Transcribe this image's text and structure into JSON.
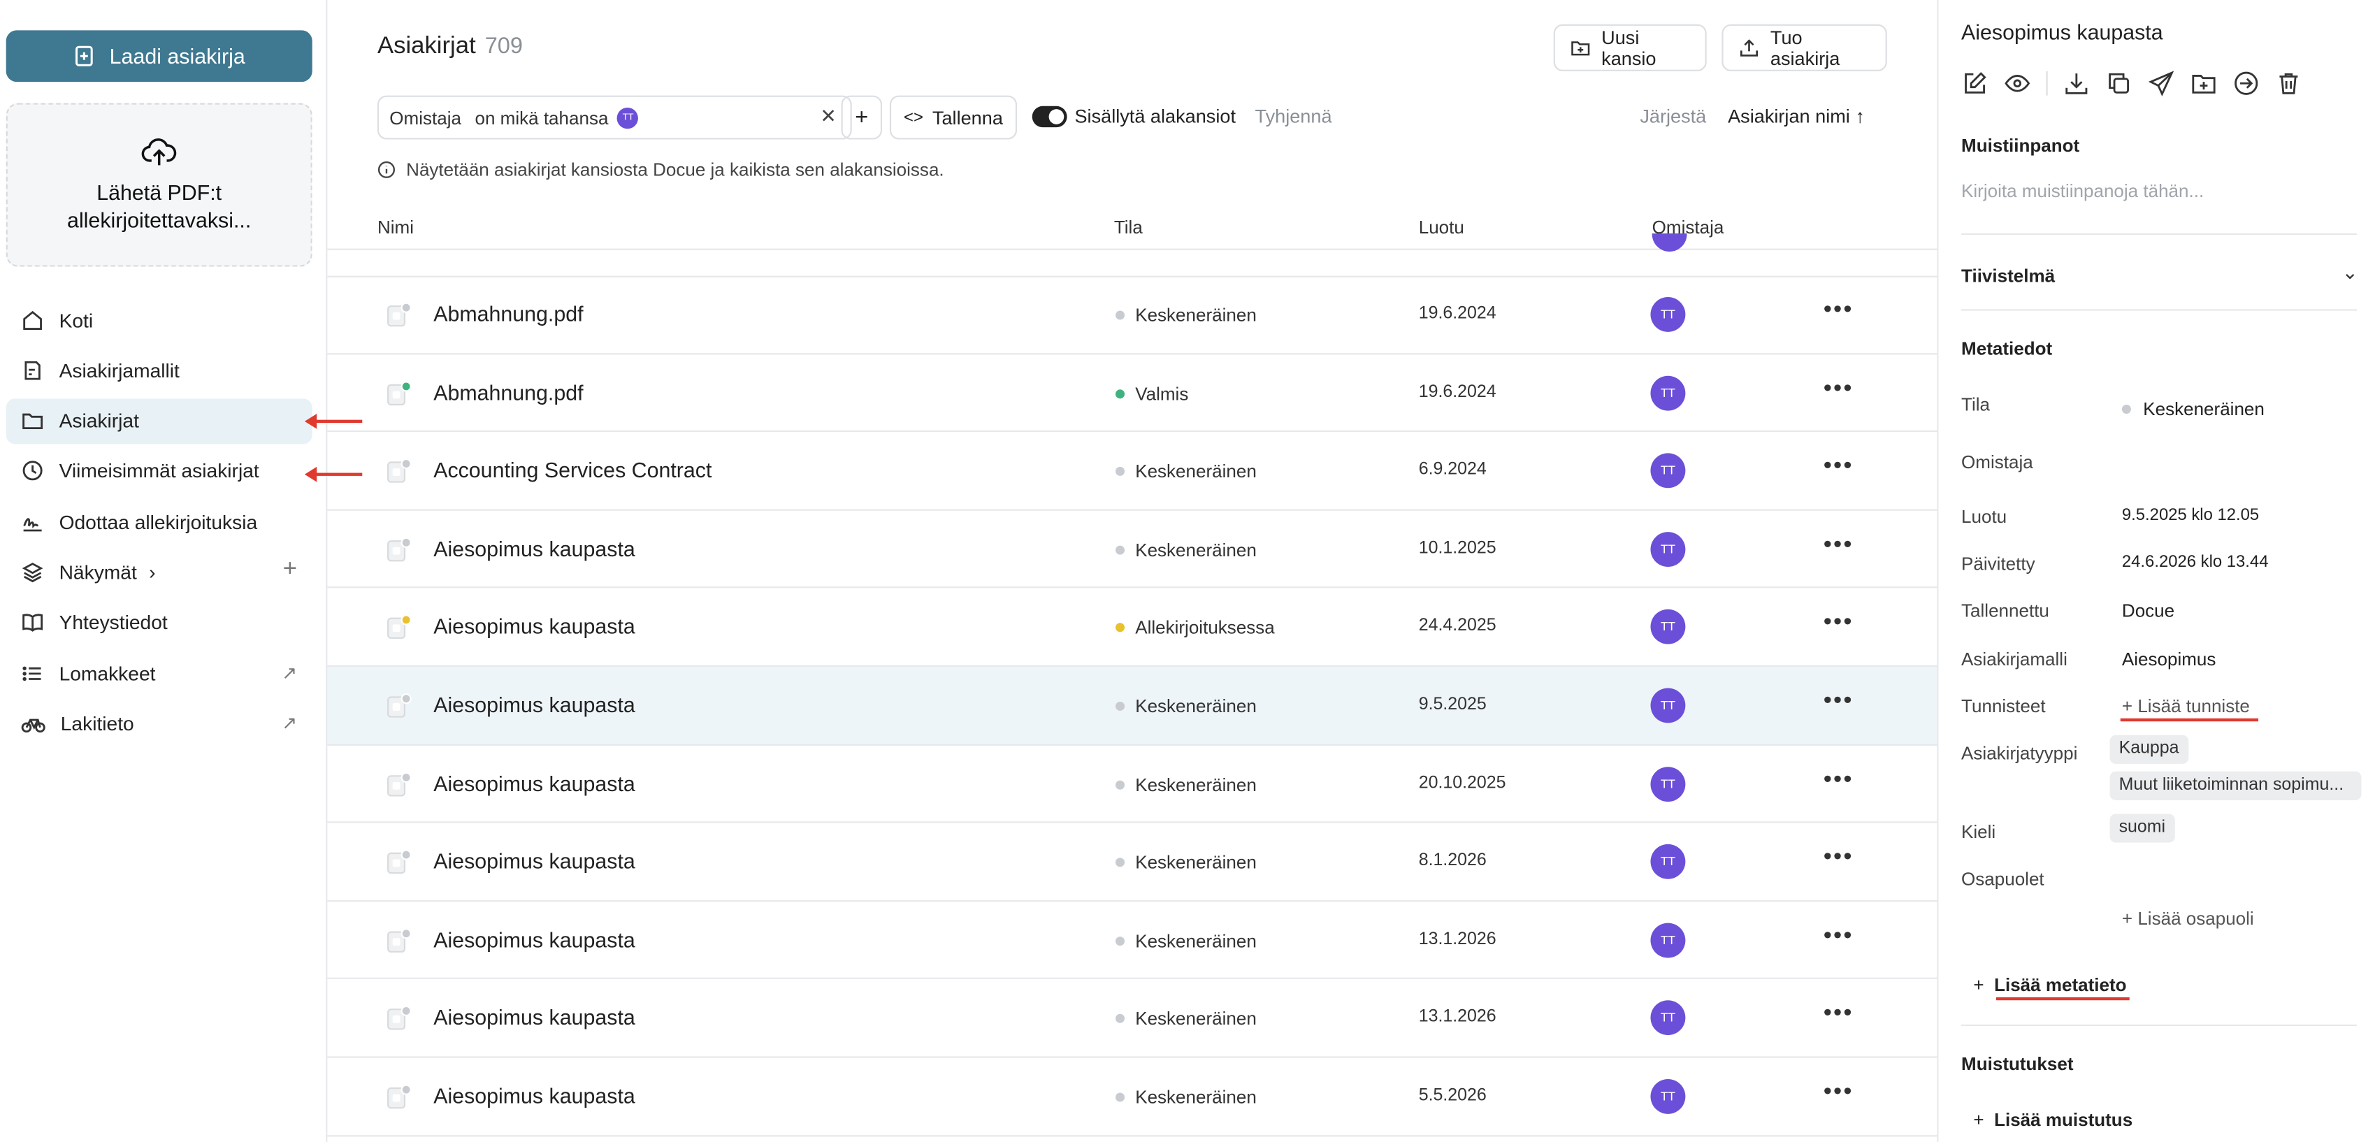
{
  "sidebar": {
    "create_button": "Laadi asiakirja",
    "upload_text": [
      "Lähetä PDF:t",
      "allekirjoitettavaksi..."
    ],
    "nav": [
      {
        "label": "Koti",
        "icon": "home-icon"
      },
      {
        "label": "Asiakirjamallit",
        "icon": "template-icon"
      },
      {
        "label": "Asiakirjat",
        "icon": "folder-icon",
        "active": true
      },
      {
        "label": "Viimeisimmät asiakirjat",
        "icon": "clock-icon"
      },
      {
        "label": "Odottaa allekirjoituksia",
        "icon": "signature-icon"
      },
      {
        "label": "Näkymät",
        "icon": "layers-icon"
      },
      {
        "label": "Yhteystiedot",
        "icon": "book-icon"
      },
      {
        "label": "Lomakkeet",
        "icon": "list-icon"
      },
      {
        "label": "Lakitieto",
        "icon": "bicycle-icon"
      }
    ]
  },
  "main": {
    "title": "Asiakirjat",
    "count": "709",
    "new_folder": "Uusi kansio",
    "import": "Tuo asiakirja",
    "filter": {
      "field": "Omistaja",
      "op": "on mikä tahansa",
      "avatar": "TT"
    },
    "save": "Tallenna",
    "include_subfolders": "Sisällytä alakansiot",
    "clear": "Tyhjennä",
    "sort_label": "Järjestä",
    "sort_value": "Asiakirjan nimi",
    "info": "Näytetään asiakirjat kansiosta Docue ja kaikista sen alakansioissa.",
    "columns": {
      "name": "Nimi",
      "status": "Tila",
      "created": "Luotu",
      "owner": "Omistaja"
    },
    "rows": [
      {
        "name": "Abmahnung.pdf",
        "status": "Keskeneräinen",
        "date": "19.6.2024",
        "owner": "TT"
      },
      {
        "name": "Abmahnung.pdf",
        "status": "Valmis",
        "date": "19.6.2024",
        "owner": "TT"
      },
      {
        "name": "Accounting Services Contract",
        "status": "Keskeneräinen",
        "date": "6.9.2024",
        "owner": "TT"
      },
      {
        "name": "Aiesopimus kaupasta",
        "status": "Keskeneräinen",
        "date": "10.1.2025",
        "owner": "TT"
      },
      {
        "name": "Aiesopimus kaupasta",
        "status": "Allekirjoituksessa",
        "date": "24.4.2025",
        "owner": "TT"
      },
      {
        "name": "Aiesopimus kaupasta",
        "status": "Keskeneräinen",
        "date": "9.5.2025",
        "owner": "TT"
      },
      {
        "name": "Aiesopimus kaupasta",
        "status": "Keskeneräinen",
        "date": "20.10.2025",
        "owner": "TT"
      },
      {
        "name": "Aiesopimus kaupasta",
        "status": "Keskeneräinen",
        "date": "8.1.2026",
        "owner": "TT"
      },
      {
        "name": "Aiesopimus kaupasta",
        "status": "Keskeneräinen",
        "date": "13.1.2026",
        "owner": "TT"
      },
      {
        "name": "Aiesopimus kaupasta",
        "status": "Keskeneräinen",
        "date": "13.1.2026",
        "owner": "TT"
      },
      {
        "name": "Aiesopimus kaupasta",
        "status": "Keskeneräinen",
        "date": "5.5.2026",
        "owner": "TT"
      }
    ]
  },
  "panel": {
    "title": "Aiesopimus kaupasta",
    "notes_heading": "Muistiinpanot",
    "notes_placeholder": "Kirjoita muistiinpanoja tähän...",
    "summary_heading": "Tiivistelmä",
    "metadata_heading": "Metatiedot",
    "meta": {
      "status_label": "Tila",
      "status": "Keskeneräinen",
      "owner_label": "Omistaja",
      "created_label": "Luotu",
      "created": "9.5.2025 klo 12.05",
      "updated_label": "Päivitetty",
      "updated": "24.6.2026 klo 13.44",
      "saved_label": "Tallennettu",
      "saved": "Docue",
      "template_label": "Asiakirjamalli",
      "template": "Aiesopimus",
      "tags_label": "Tunnisteet",
      "add_tag": "Lisää tunniste",
      "doctype_label": "Asiakirjatyyppi",
      "doctype1": "Kauppa",
      "doctype2": "Muut liiketoiminnan sopimu...",
      "lang_label": "Kieli",
      "lang": "suomi",
      "parties_label": "Osapuolet",
      "add_party": "Lisää osapuoli"
    },
    "add_metadata": "Lisää metatieto",
    "reminders_heading": "Muistutukset",
    "add_reminder": "Lisää muistutus"
  },
  "colors": {
    "accent": "#3e7891",
    "avatar": "#6c4fd8",
    "status_valmis": "#3fb37f",
    "status_allekirjoituksessa": "#e9c12d",
    "status_default": "#c8ccd0",
    "annotation": "#e03a2f"
  }
}
